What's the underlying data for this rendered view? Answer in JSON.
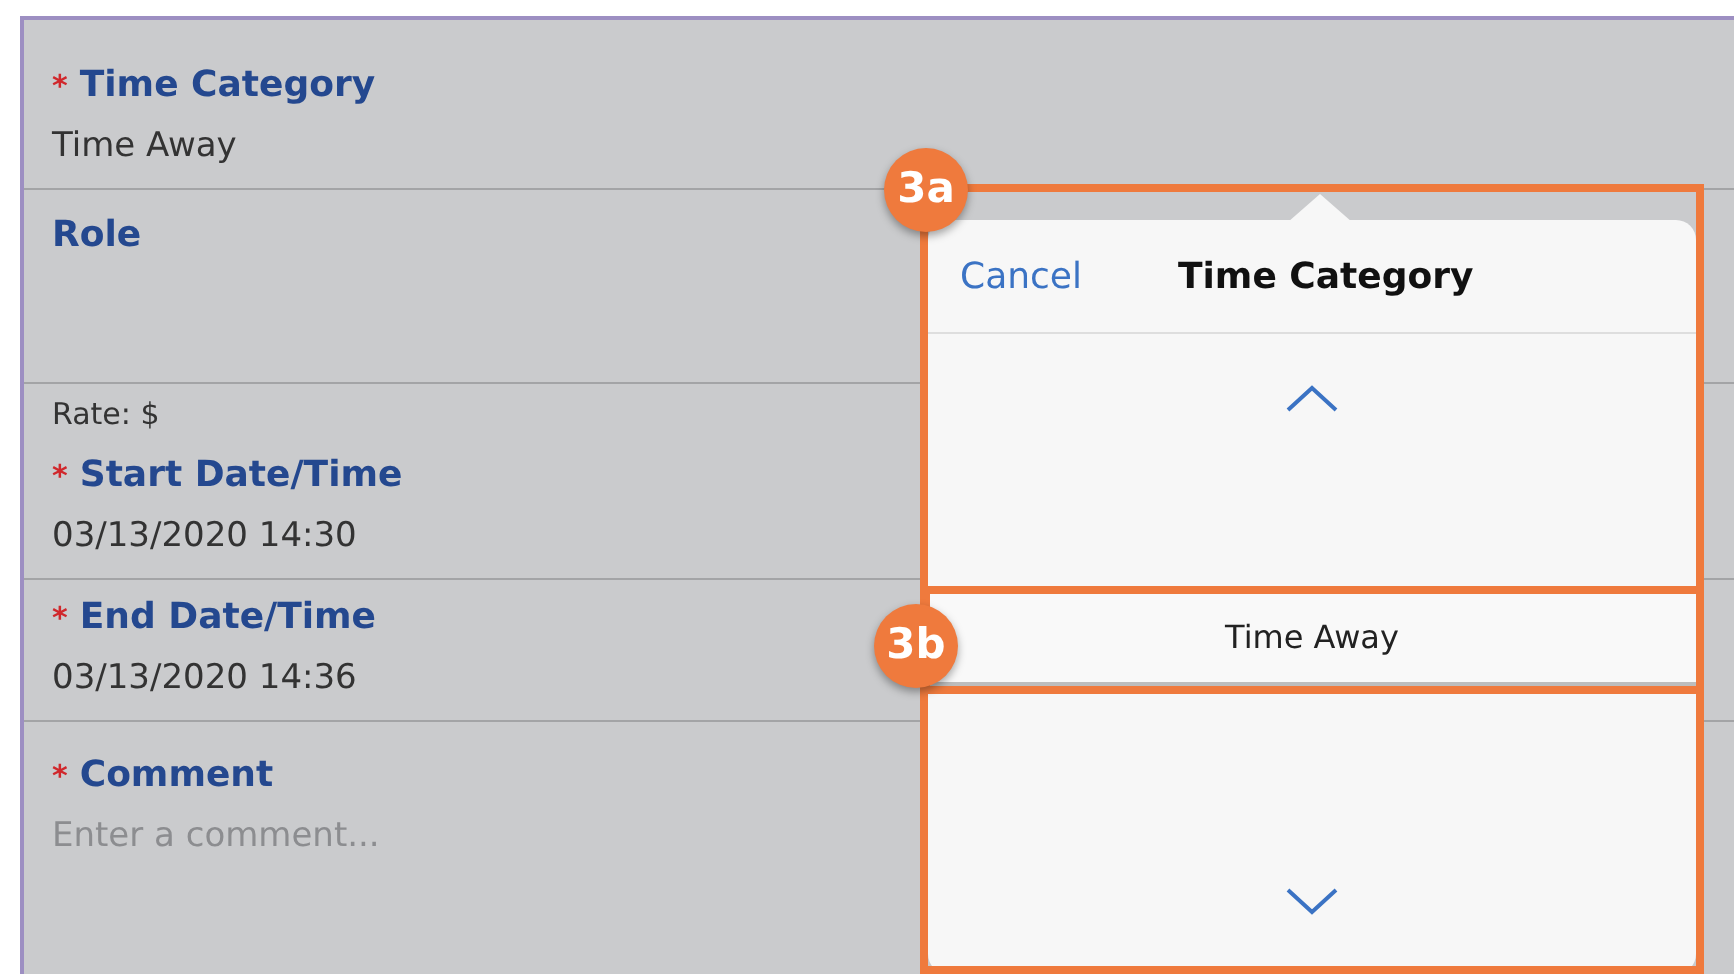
{
  "form": {
    "fields": [
      {
        "kind": "field",
        "required_mark": "*",
        "label": "Time Category",
        "value": "Time Away"
      },
      {
        "kind": "field",
        "label": "Role"
      },
      {
        "kind": "note",
        "text": "Rate: $"
      },
      {
        "kind": "field",
        "required_mark": "*",
        "label": "Start Date/Time",
        "value": "03/13/2020 14:30"
      },
      {
        "kind": "field",
        "required_mark": "*",
        "label": "End Date/Time",
        "value": "03/13/2020 14:36"
      },
      {
        "kind": "field",
        "required_mark": "*",
        "label": "Comment",
        "placeholder": "Enter a comment..."
      }
    ]
  },
  "picker_popover": {
    "cancel": "Cancel",
    "title": "Time Category",
    "selected_option": "Time Away"
  },
  "annotations": [
    {
      "label": "3a"
    },
    {
      "label": "3b"
    }
  ]
}
